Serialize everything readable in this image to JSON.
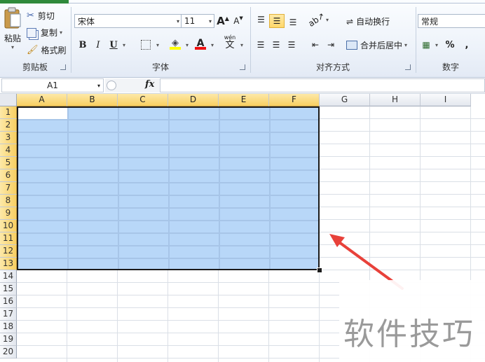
{
  "ribbon": {
    "clipboard": {
      "label": "剪贴板",
      "paste": "粘贴",
      "cut": "剪切",
      "copy": "复制",
      "format_painter": "格式刷"
    },
    "font": {
      "label": "字体",
      "font_name": "宋体",
      "font_size": "11",
      "bold": "B",
      "italic": "I",
      "underline": "U",
      "grow": "A",
      "shrink": "A",
      "font_color": "A",
      "phonetic": "wén"
    },
    "alignment": {
      "label": "对齐方式",
      "wrap_text": "自动换行",
      "merge_center": "合并后居中"
    },
    "number": {
      "label": "数字",
      "format": "常规",
      "percent": "%",
      "comma": ","
    }
  },
  "formula_bar": {
    "name_box": "A1",
    "fx": "fx",
    "content": ""
  },
  "sheet": {
    "columns": [
      "A",
      "B",
      "C",
      "D",
      "E",
      "F",
      "G",
      "H",
      "I"
    ],
    "rows": [
      "1",
      "2",
      "3",
      "4",
      "5",
      "6",
      "7",
      "8",
      "9",
      "10",
      "11",
      "12",
      "13",
      "14",
      "15",
      "16",
      "17",
      "18",
      "19",
      "20"
    ],
    "selected_range": "A1:F13",
    "active_cell": "A1"
  },
  "annotation": {
    "arrow_color": "#e8413a"
  },
  "watermark": "软件技巧",
  "colors": {
    "selection_fill": "#b8d7f8",
    "header_selected": "#f8cf62",
    "ribbon_bg": "#eef3fa"
  }
}
